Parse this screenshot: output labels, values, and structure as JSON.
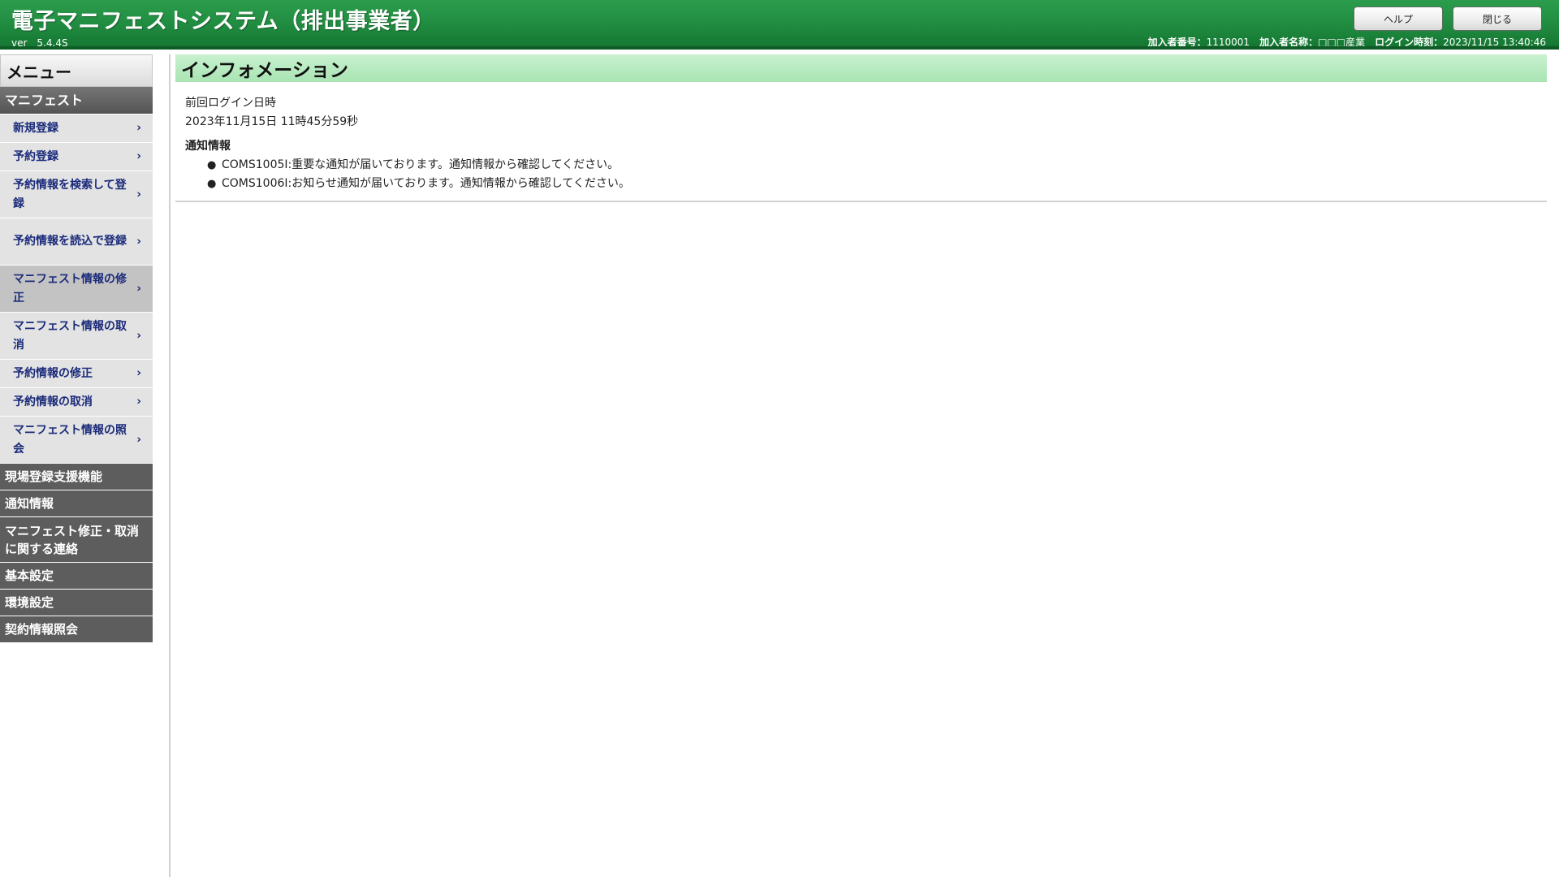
{
  "header": {
    "title": "電子マニフェストシステム（排出事業者）",
    "version": "ver　5.4.4S",
    "help_label": "ヘルプ",
    "close_label": "閉じる",
    "user": {
      "member_no_label": "加入者番号：",
      "member_no": "1110001",
      "member_name_label": "加入者名称：",
      "member_name": "□□□産業",
      "login_time_label": "ログイン時刻：",
      "login_time": "2023/11/15 13:40:46"
    }
  },
  "sidebar": {
    "menu_title": "メニュー",
    "manifest_section": "マニフェスト",
    "manifest_items": [
      {
        "label": "新規登録"
      },
      {
        "label": "予約登録"
      },
      {
        "label": "予約情報を検索して登録"
      },
      {
        "label": "予約情報を読込で登録"
      },
      {
        "label": "マニフェスト情報の修正"
      },
      {
        "label": "マニフェスト情報の取消"
      },
      {
        "label": "予約情報の修正"
      },
      {
        "label": "予約情報の取消"
      },
      {
        "label": "マニフェスト情報の照会"
      }
    ],
    "other_sections": [
      {
        "label": "現場登録支援機能"
      },
      {
        "label": "通知情報"
      },
      {
        "label": "マニフェスト修正・取消に関する連絡"
      },
      {
        "label": "基本設定"
      },
      {
        "label": "環境設定"
      },
      {
        "label": "契約情報照会"
      }
    ],
    "chevron": "›"
  },
  "main": {
    "page_title": "インフォメーション",
    "last_login_label": "前回ログイン日時",
    "last_login_value": "2023年11月15日 11時45分59秒",
    "notifications_heading": "通知情報",
    "bullet": "●",
    "notifications": [
      "COMS1005I:重要な通知が届いております。通知情報から確認してください。",
      "COMS1006I:お知らせ通知が届いております。通知情報から確認してください。"
    ]
  },
  "colors": {
    "header_green": "#1f8a3f",
    "title_band": "#b4e8bd",
    "sidebar_dark": "#5d5d5d",
    "sidebar_light": "#e3e3e3",
    "link_navy": "#1a2a7a"
  }
}
